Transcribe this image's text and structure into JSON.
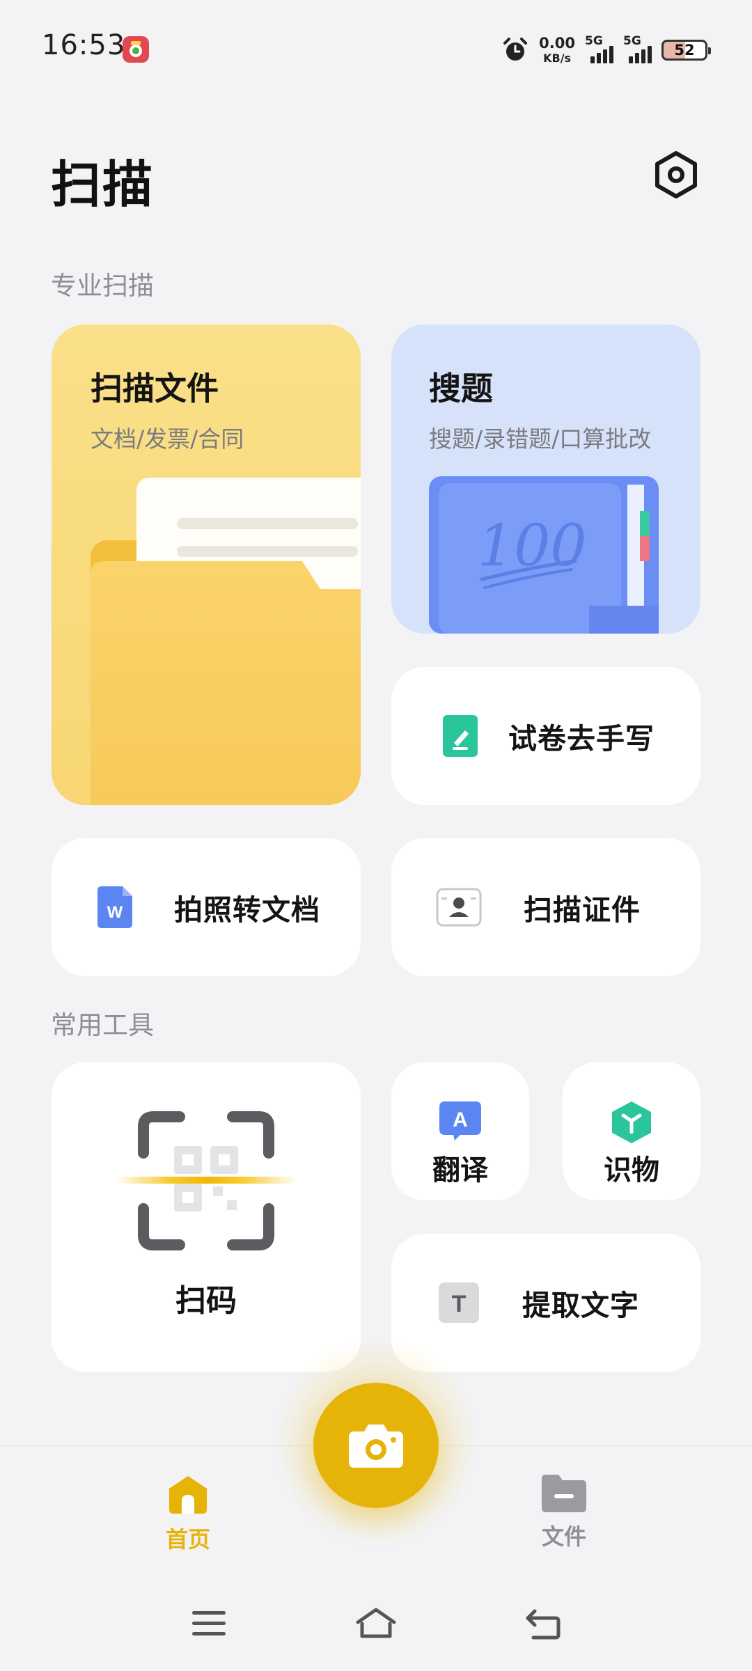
{
  "status_bar": {
    "time": "16:53",
    "app_icon_text": "",
    "net_speed_value": "0.00",
    "net_speed_unit": "KB/s",
    "signal1_label": "5G",
    "signal2_label": "5G",
    "battery": "52"
  },
  "header": {
    "title": "扫描",
    "settings_icon": "settings-hexagon-icon"
  },
  "sections": {
    "pro": "专业扫描",
    "tools": "常用工具"
  },
  "cards": {
    "scan_doc": {
      "title": "扫描文件",
      "subtitle": "文档/发票/合同"
    },
    "search_q": {
      "title": "搜题",
      "subtitle": "搜题/录错题/口算批改",
      "illustration_text": "100"
    },
    "remove_handwriting": {
      "label": "试卷去手写"
    },
    "photo_to_doc": {
      "label": "拍照转文档",
      "icon_letter": "W"
    },
    "scan_id": {
      "label": "扫描证件"
    },
    "scan_code": {
      "label": "扫码"
    },
    "translate": {
      "label": "翻译",
      "icon_letter": "A"
    },
    "identify": {
      "label": "识物"
    },
    "extract_text": {
      "label": "提取文字",
      "icon_letter": "T"
    }
  },
  "bottom_nav": {
    "home": "首页",
    "files": "文件"
  },
  "colors": {
    "accent": "#E6B409",
    "home_active": "#E6B409",
    "inactive": "#8E8E93"
  }
}
